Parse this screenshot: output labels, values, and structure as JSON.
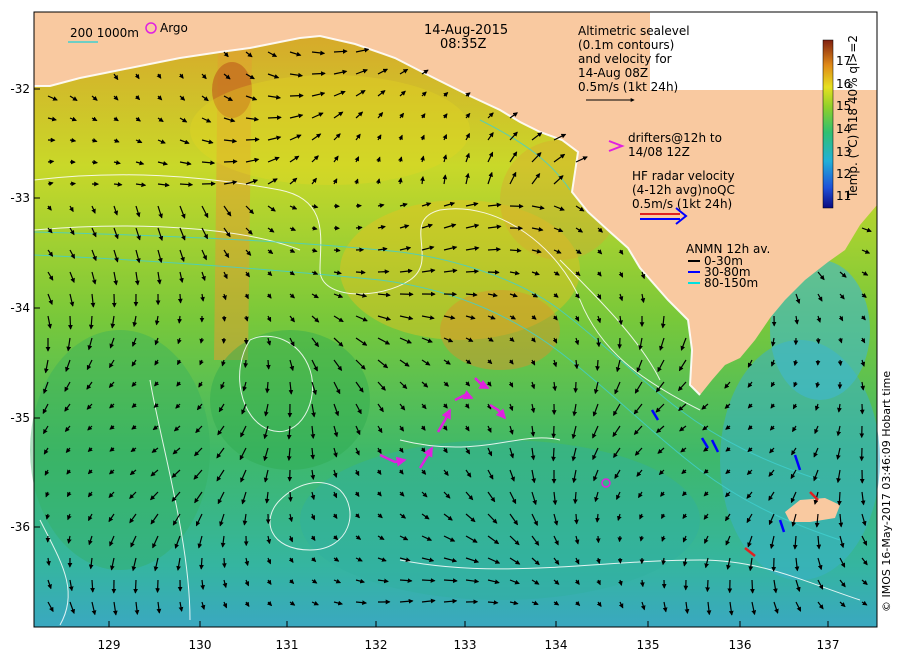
{
  "title": {
    "date": "14-Aug-2015",
    "time": "08:35Z"
  },
  "legend": {
    "depth_line": "200  1000m",
    "argo": "Argo",
    "altimetric": [
      "Altimetric sealevel",
      "(0.1m contours)",
      "and velocity for",
      "14-Aug 08Z",
      "0.5m/s (1kt 24h)"
    ],
    "drifters": [
      "drifters@12h to",
      "14/08 12Z"
    ],
    "hf_radar": [
      "HF radar velocity",
      "(4-12h avg)noQC",
      "0.5m/s (1kt 24h)"
    ],
    "anmn": {
      "title": "ANMN 12h av.",
      "items": [
        {
          "label": "0-30m",
          "color": "#000000"
        },
        {
          "label": "30-80m",
          "color": "#0000ff"
        },
        {
          "label": "80-150m",
          "color": "#00e0e0"
        }
      ]
    }
  },
  "axes": {
    "lat_ticks": [
      "-32",
      "-33",
      "-34",
      "-35",
      "-36"
    ],
    "lon_ticks": [
      "129",
      "130",
      "131",
      "132",
      "133",
      "134",
      "135",
      "136",
      "137"
    ]
  },
  "colorbar": {
    "ticks": [
      "17",
      "16",
      "15",
      "14",
      "13",
      "12",
      "11"
    ],
    "label": "Temp. (°C) n18 40% ql>=2",
    "range": [
      10.5,
      17.8
    ]
  },
  "copyright": "© IMOS 16-May-2017 03:46:09 Hobart time",
  "colors": {
    "land": "#f9c9a0",
    "arrow": "#000000",
    "drifter": "#e020e0",
    "contour": "#ffffff",
    "isobath": "#40d0d0"
  }
}
